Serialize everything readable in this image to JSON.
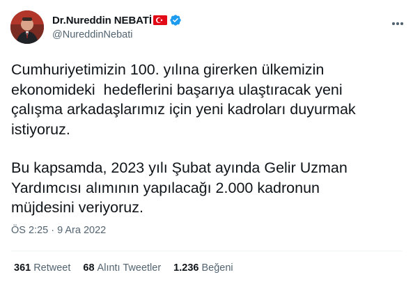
{
  "author": {
    "display_name": "Dr.Nureddin NEBATİ",
    "handle": "@NureddinNebati",
    "flag_icon": "turkey-flag-icon",
    "verified_icon": "verified-badge-icon"
  },
  "tweet": {
    "paragraph1": "Cumhuriyetimizin 100. yılına girerken ülkemizin\nekonomideki  hedeflerini başarıya ulaştıracak yeni\nçalışma arkadaşlarımız için yeni kadroları duyurmak\nistiyoruz.",
    "paragraph2": "Bu kapsamda, 2023 yılı Şubat ayında Gelir Uzman\nYardımcısı alımının yapılacağı 2.000 kadronun\nmüjdesini veriyoruz.",
    "timestamp": "ÖS 2:25 · 9 Ara 2022"
  },
  "stats": {
    "retweets": {
      "count": "361",
      "label": "Retweet"
    },
    "quotes": {
      "count": "68",
      "label": "Alıntı Tweetler"
    },
    "likes": {
      "count": "1.236",
      "label": "Beğeni"
    }
  },
  "colors": {
    "text": "#0f1419",
    "secondary": "#536471",
    "verified": "#1d9bf0",
    "flag_red": "#e30a17",
    "divider": "#eff3f4"
  }
}
